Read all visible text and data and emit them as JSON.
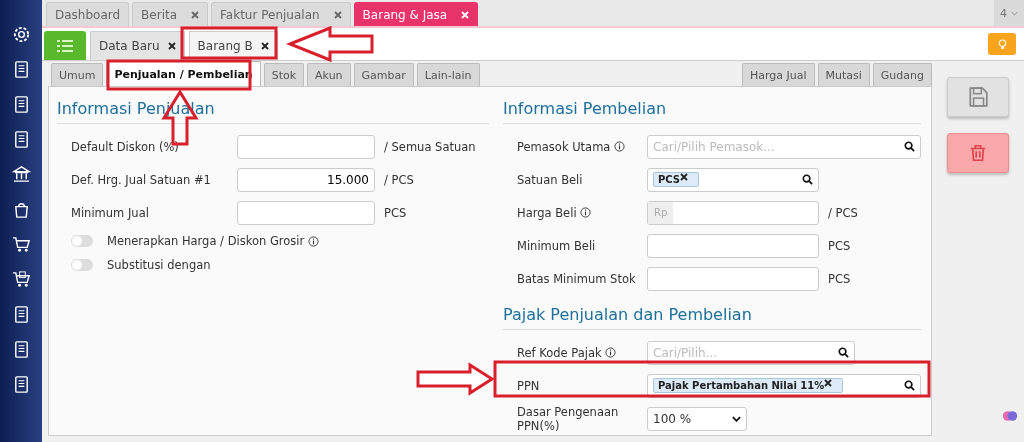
{
  "main_tabs": [
    {
      "label": "Dashboard",
      "closable": false,
      "selected": false
    },
    {
      "label": "Berita",
      "closable": true,
      "selected": false
    },
    {
      "label": "Faktur Penjualan",
      "closable": true,
      "selected": false
    },
    {
      "label": "Barang & Jasa",
      "closable": true,
      "selected": true
    }
  ],
  "tab_count": "4",
  "sub_tabs": [
    {
      "label": "Data Baru",
      "selected": false
    },
    {
      "label": "Barang B",
      "selected": true
    }
  ],
  "section_tabs_left": [
    {
      "label": "Umum",
      "selected": false
    },
    {
      "label": "Penjualan / Pembelian",
      "selected": true
    },
    {
      "label": "Stok",
      "selected": false
    },
    {
      "label": "Akun",
      "selected": false
    },
    {
      "label": "Gambar",
      "selected": false
    },
    {
      "label": "Lain-lain",
      "selected": false
    }
  ],
  "section_tabs_right": [
    {
      "label": "Harga Jual",
      "selected": false
    },
    {
      "label": "Mutasi",
      "selected": false
    },
    {
      "label": "Gudang",
      "selected": false
    }
  ],
  "sales": {
    "title": "Informasi Penjualan",
    "fields": [
      {
        "label": "Default Diskon (%)",
        "kind": "input",
        "unit": "/ Semua Satuan",
        "info": false
      },
      {
        "label": "Def. Hrg. Jual Satuan #1",
        "kind": "input",
        "value": "15.000",
        "unit": "/ PCS",
        "info": false
      },
      {
        "label": "Minimum Jual",
        "kind": "input",
        "unit": "PCS",
        "info": false
      }
    ],
    "toggles": [
      {
        "label": "Menerapkan Harga / Diskon Grosir",
        "on": false,
        "info": true
      },
      {
        "label": "Substitusi dengan",
        "on": false,
        "info": false
      }
    ]
  },
  "purchase": {
    "title": "Informasi Pembelian",
    "fields": [
      {
        "label": "Pemasok Utama",
        "kind": "search",
        "placeholder": "Cari/Pilih Pemasok...",
        "info": true
      },
      {
        "label": "Satuan Beli",
        "kind": "tags",
        "tags": [
          "PCS"
        ],
        "info": false
      },
      {
        "label": "Harga Beli",
        "kind": "prefix",
        "prefix": "Rp",
        "unit": "/ PCS",
        "info": true
      },
      {
        "label": "Minimum Beli",
        "kind": "input",
        "unit": "PCS",
        "info": false
      },
      {
        "label": "Batas Minimum Stok",
        "kind": "input",
        "unit": "PCS",
        "info": false
      }
    ]
  },
  "tax": {
    "title": "Pajak Penjualan dan Pembelian",
    "fields": [
      {
        "label": "Ref Kode Pajak",
        "kind": "search",
        "placeholder": "Cari/Pilih...",
        "info": true
      },
      {
        "label": "PPN",
        "kind": "tags",
        "tags": [
          "Pajak Pertambahan Nilai 11%"
        ],
        "info": false
      },
      {
        "label": "Dasar Pengenaan PPN(%)",
        "kind": "select",
        "value": "100 %",
        "info": false
      }
    ]
  }
}
